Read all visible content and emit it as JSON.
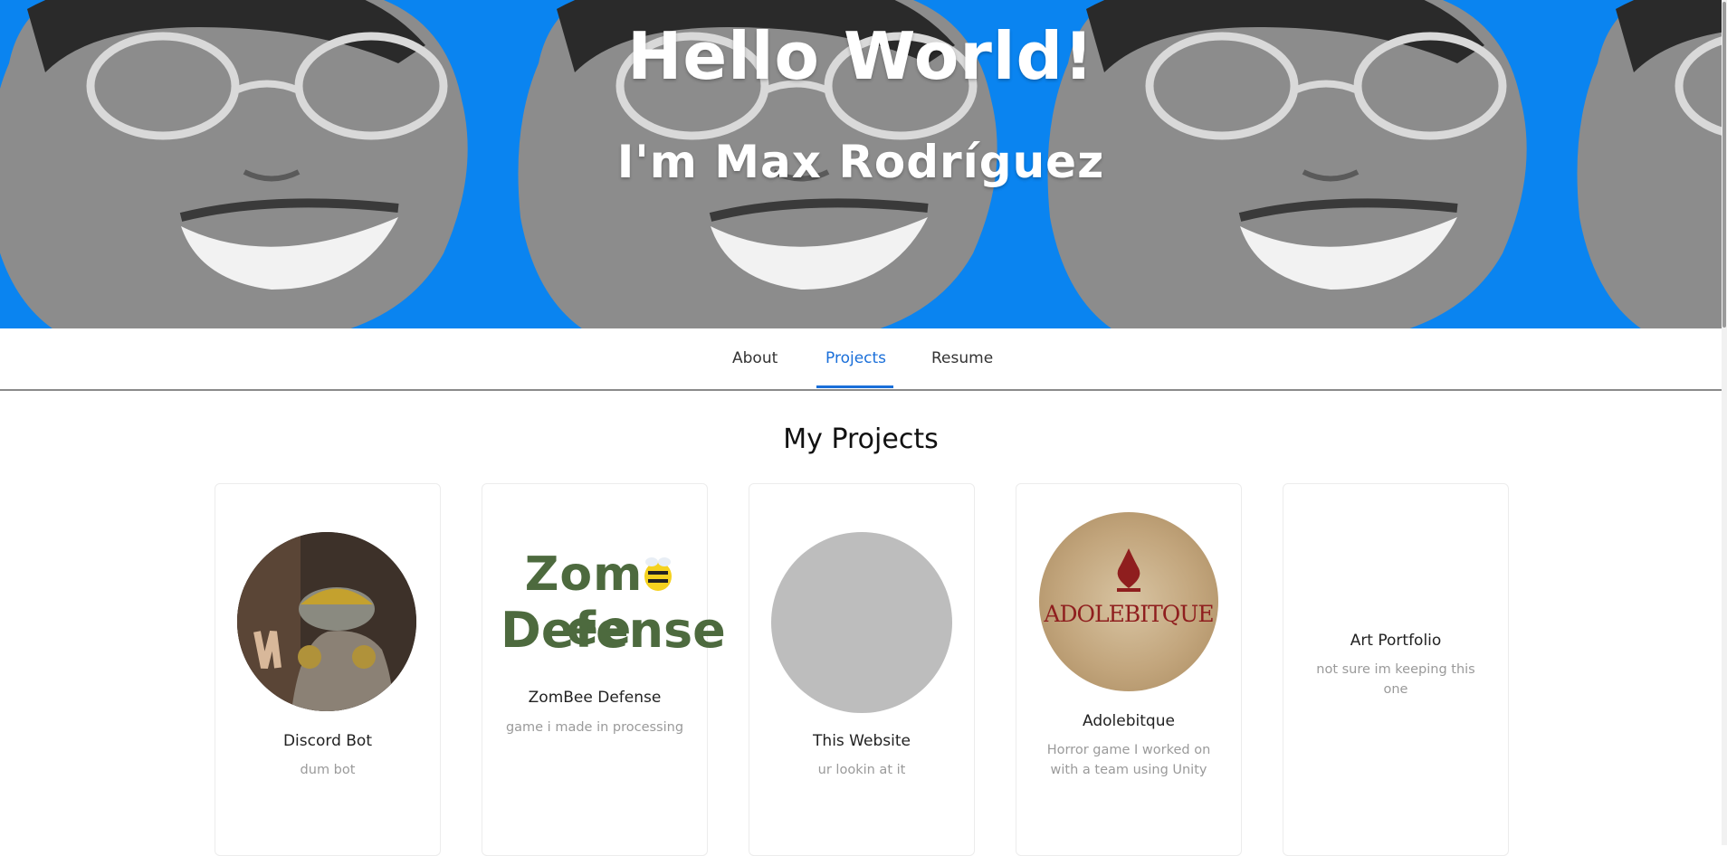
{
  "hero": {
    "title": "Hello World!",
    "subtitle": "I'm Max Rodríguez",
    "background_color": "#0a84f0"
  },
  "nav": {
    "tabs": [
      {
        "label": "About"
      },
      {
        "label": "Projects"
      },
      {
        "label": "Resume"
      }
    ],
    "active_tab": "Projects",
    "accent_color": "#1a6fd9"
  },
  "projects": {
    "heading": "My Projects",
    "cards": [
      {
        "name": "Discord Bot",
        "description": "dum bot",
        "image": "photo"
      },
      {
        "name": "ZomBee Defense",
        "description": "game i made in processing",
        "image": "logo",
        "logo_line1_a": "Zom",
        "logo_line1_b": "ee",
        "logo_line2": "Defense"
      },
      {
        "name": "This Website",
        "description": "ur lookin at it",
        "image": "gray-placeholder"
      },
      {
        "name": "Adolebitque",
        "description": "Horror game I worked on with a team using Unity",
        "image": "logo",
        "logo_text": "ADOLEBITQUE"
      },
      {
        "name": "Art Portfolio",
        "description": "not sure im keeping this one",
        "image": "none"
      }
    ]
  }
}
